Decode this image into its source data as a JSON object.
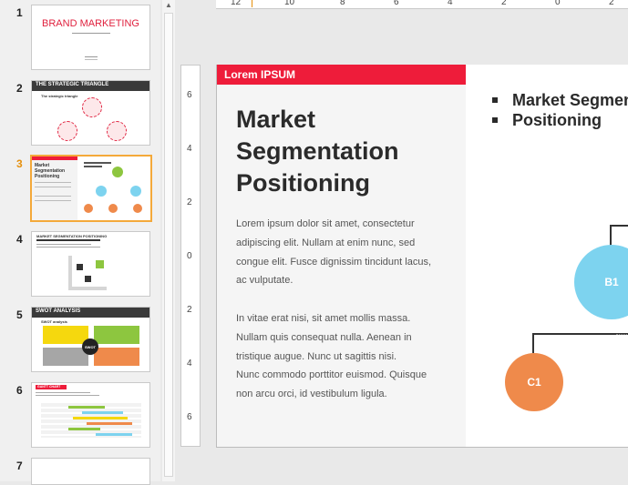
{
  "thumbnails": [
    {
      "num": "1",
      "title": "BRAND MARKETING",
      "selected": false
    },
    {
      "num": "2",
      "title": "THE STRATEGIC TRIANGLE",
      "sub": "The strategic triangle",
      "selected": false
    },
    {
      "num": "3",
      "title": "Market Segmentation Positioning",
      "selected": true
    },
    {
      "num": "4",
      "title": "MARKET SEGMENTATION POSITIONING",
      "selected": false
    },
    {
      "num": "5",
      "title": "SWOT ANALYSIS",
      "sub": "SWOT analysis",
      "center": "SWOT",
      "selected": false
    },
    {
      "num": "6",
      "title": "GANTT CHART",
      "selected": false
    },
    {
      "num": "7",
      "title": "",
      "selected": false
    }
  ],
  "ruler": {
    "top": [
      "12",
      "10",
      "8",
      "6",
      "4",
      "2",
      "0",
      "2"
    ],
    "left": [
      "6",
      "4",
      "2",
      "0",
      "2",
      "4",
      "6"
    ]
  },
  "slide": {
    "header_tag": "Lorem  IPSUM",
    "title_lines": [
      "Market",
      "Segmentation",
      "Positioning"
    ],
    "paragraph1": [
      "Lorem ipsum dolor sit amet, consectetur",
      "adipiscing elit. Nullam at enim nunc, sed",
      "congue elit. Fusce dignissim tincidunt lacus,",
      "ac vulputate."
    ],
    "paragraph2": [
      "In vitae erat nisi, sit amet mollis massa.",
      "Nullam quis consequat nulla. Aenean in",
      "tristique augue. Nunc ut sagittis nisi.",
      "Nunc commodo porttitor euismod. Quisque",
      "non arcu orci, id vestibulum ligula."
    ],
    "bullets": [
      "Market Segmentation",
      "Positioning"
    ],
    "nodes": [
      {
        "label": "B1",
        "color": "#7dd3ef"
      },
      {
        "label": "C1",
        "color": "#ef8a4b"
      }
    ]
  },
  "colors": {
    "accent_red": "#ee1c3a",
    "selection": "#f4a93a"
  }
}
